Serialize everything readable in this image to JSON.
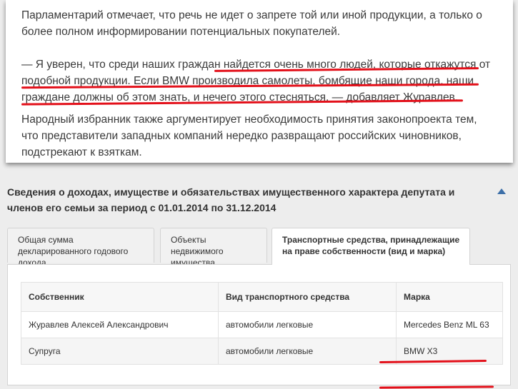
{
  "article": {
    "paragraph1": "Парламентарий отмечает, что речь не идет о запрете той или иной продукции, а только о более полном информировании потенциальных покупателей.",
    "paragraph2": "— Я уверен, что среди наших граждан найдется очень много людей, которые откажутся от подобной продукции. Если BMW производила самолеты, бомбящие наши города, наши граждане должны об этом знать, и нечего этого стесняться, — добавляет Журавлев.",
    "paragraph3": "Народный избранник также аргументирует необходимость принятия законопроекта тем, что представители западных компаний нередко развращают российских чиновников, подстрекают к взяткам."
  },
  "declaration": {
    "title": "Сведения о доходах, имуществе и обязательствах имущественного характера депутата и членов его семьи за период с 01.01.2014 по 31.12.2014",
    "collapse_icon": "triangle-up-icon",
    "tabs": [
      {
        "label": "Общая сумма декларированного годового дохода",
        "active": false
      },
      {
        "label": "Объекты недвижимого имущества",
        "active": false
      },
      {
        "label": "Транспортные средства, принадлежащие на праве собственности (вид и марка)",
        "active": true
      }
    ],
    "table": {
      "headers": [
        "Собственник",
        "Вид транспортного средства",
        "Марка"
      ],
      "rows": [
        [
          "Журавлев Алексей Александрович",
          "автомобили легковые",
          "Mercedes Benz ML 63"
        ],
        [
          "Супруга",
          "автомобили легковые",
          "BMW X3"
        ]
      ]
    }
  },
  "colors": {
    "highlight_underline": "#e3101a",
    "collapse_icon": "#3d6fa8"
  }
}
